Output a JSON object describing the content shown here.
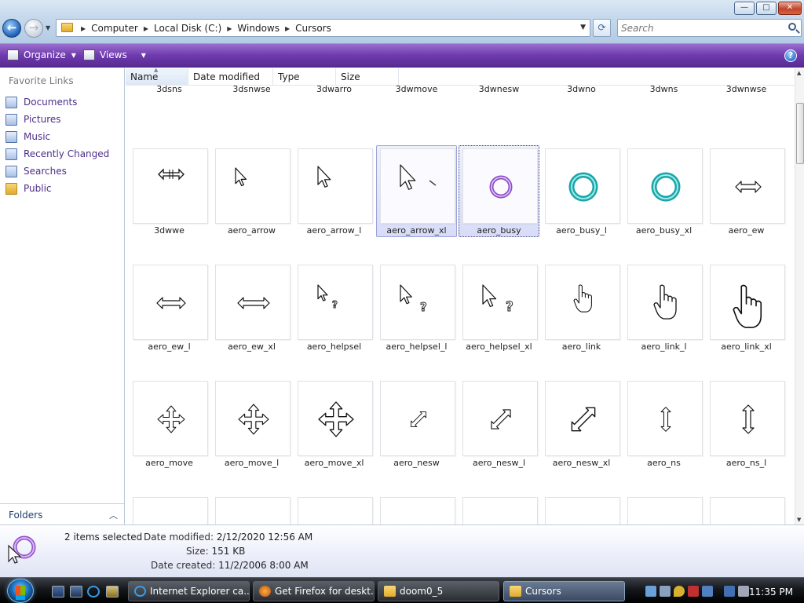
{
  "window": {
    "controls": {
      "minimize": "—",
      "maximize": "□",
      "close": "✕"
    }
  },
  "address": {
    "crumbs": [
      "Computer",
      "Local Disk (C:)",
      "Windows",
      "Cursors"
    ]
  },
  "search": {
    "placeholder": "Search"
  },
  "toolbar": {
    "organize": "Organize",
    "views": "Views",
    "help": "?"
  },
  "nav": {
    "heading": "Favorite Links",
    "items": [
      {
        "label": "Documents",
        "icon": "documents-icon"
      },
      {
        "label": "Pictures",
        "icon": "pictures-icon"
      },
      {
        "label": "Music",
        "icon": "music-icon"
      },
      {
        "label": "Recently Changed",
        "icon": "recently-changed-icon"
      },
      {
        "label": "Searches",
        "icon": "searches-icon"
      },
      {
        "label": "Public",
        "icon": "folder-icon"
      }
    ],
    "folders_label": "Folders"
  },
  "columns": [
    "Name",
    "Date modified",
    "Type",
    "Size"
  ],
  "files": [
    {
      "name": "3dsns",
      "icon": "partial-row"
    },
    {
      "name": "3dsnwse",
      "icon": "partial-row"
    },
    {
      "name": "3dwarro",
      "icon": "partial-row"
    },
    {
      "name": "3dwmove",
      "icon": "partial-row"
    },
    {
      "name": "3dwnesw",
      "icon": "partial-row"
    },
    {
      "name": "3dwno",
      "icon": "partial-row"
    },
    {
      "name": "3dwns",
      "icon": "partial-row"
    },
    {
      "name": "3dwnwse",
      "icon": "partial-row"
    },
    {
      "name": "3dwwe",
      "icon": "ew-3d-icon"
    },
    {
      "name": "aero_arrow",
      "icon": "arrow-icon"
    },
    {
      "name": "aero_arrow_l",
      "icon": "arrow-icon"
    },
    {
      "name": "aero_arrow_xl",
      "icon": "arrow-icon",
      "selected": true
    },
    {
      "name": "aero_busy",
      "icon": "busy-ring-purple-icon",
      "selected": true,
      "focused": true
    },
    {
      "name": "aero_busy_l",
      "icon": "busy-ring-icon"
    },
    {
      "name": "aero_busy_xl",
      "icon": "busy-ring-icon"
    },
    {
      "name": "aero_ew",
      "icon": "ew-icon"
    },
    {
      "name": "aero_ew_l",
      "icon": "ew-icon"
    },
    {
      "name": "aero_ew_xl",
      "icon": "ew-icon"
    },
    {
      "name": "aero_helpsel",
      "icon": "helpsel-icon"
    },
    {
      "name": "aero_helpsel_l",
      "icon": "helpsel-icon"
    },
    {
      "name": "aero_helpsel_xl",
      "icon": "helpsel-icon"
    },
    {
      "name": "aero_link",
      "icon": "hand-icon"
    },
    {
      "name": "aero_link_l",
      "icon": "hand-icon"
    },
    {
      "name": "aero_link_xl",
      "icon": "hand-icon"
    },
    {
      "name": "aero_move",
      "icon": "move-icon"
    },
    {
      "name": "aero_move_l",
      "icon": "move-icon"
    },
    {
      "name": "aero_move_xl",
      "icon": "move-icon"
    },
    {
      "name": "aero_nesw",
      "icon": "nesw-icon"
    },
    {
      "name": "aero_nesw_l",
      "icon": "nesw-icon"
    },
    {
      "name": "aero_nesw_xl",
      "icon": "nesw-icon"
    },
    {
      "name": "aero_ns",
      "icon": "ns-icon"
    },
    {
      "name": "aero_ns_l",
      "icon": "ns-icon"
    }
  ],
  "details": {
    "count": "2 items selected",
    "rows": [
      {
        "key": "Date modified:",
        "value": "2/12/2020 12:56 AM"
      },
      {
        "key": "Size:",
        "value": "151 KB"
      },
      {
        "key": "Date created:",
        "value": "11/2/2006 8:00 AM"
      }
    ]
  },
  "taskbar": {
    "tasks": [
      {
        "label": "Internet Explorer ca...",
        "icon": "ie-icon"
      },
      {
        "label": "Get Firefox for deskt...",
        "icon": "firefox-icon"
      },
      {
        "label": "doom0_5",
        "icon": "folder-icon"
      },
      {
        "label": "Cursors",
        "icon": "folder-icon",
        "active": true
      }
    ],
    "clock": "11:35 PM"
  },
  "colors": {
    "accent": "#6f3aae",
    "link": "#4e2e8a",
    "selection": "#d8dcf7"
  }
}
